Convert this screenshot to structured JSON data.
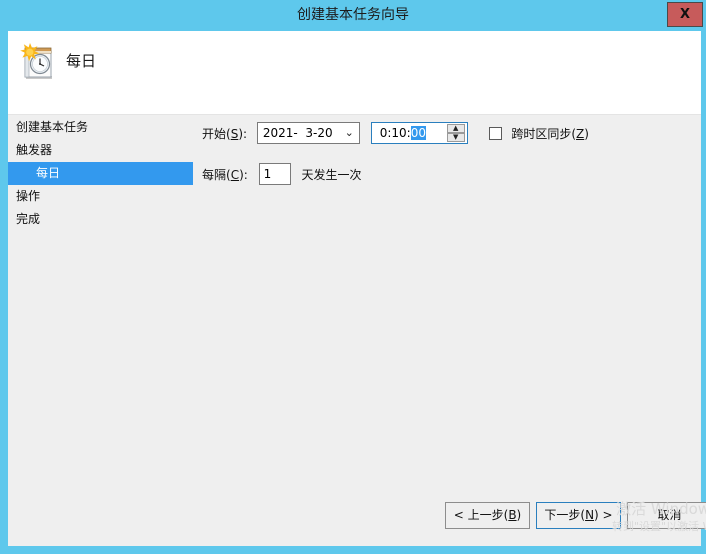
{
  "window": {
    "title": "创建基本任务向导",
    "close_label": "X",
    "frame_color": "#5ec8ec",
    "close_color": "#c75b5b"
  },
  "header": {
    "icon": "calendar-clock-icon",
    "title": "每日"
  },
  "sidebar": {
    "items": [
      {
        "label": "创建基本任务",
        "selected": false,
        "sub": false
      },
      {
        "label": "触发器",
        "selected": false,
        "sub": false
      },
      {
        "label": "每日",
        "selected": true,
        "sub": true
      },
      {
        "label": "操作",
        "selected": false,
        "sub": false
      },
      {
        "label": "完成",
        "selected": false,
        "sub": false
      }
    ],
    "selected_color": "#3399ee"
  },
  "form": {
    "start": {
      "label_pre": "开始(",
      "label_key": "S",
      "label_post": "):",
      "date_value": "2021-  3-20",
      "date_chevron": "chevron-down-icon",
      "time_prefix": "0:10:",
      "time_selected": "00",
      "spin_up": "▲",
      "spin_down": "▼"
    },
    "sync_checkbox": {
      "checked": false,
      "label_pre": "跨时区同步(",
      "label_key": "Z",
      "label_post": ")"
    },
    "recur": {
      "label_pre": "每隔(",
      "label_key": "C",
      "label_post": "):",
      "value": "1",
      "suffix": "天发生一次"
    }
  },
  "footer": {
    "back": {
      "pre": "< 上一步(",
      "key": "B",
      "post": ")"
    },
    "next": {
      "pre": "下一步(",
      "key": "N",
      "post": ") >"
    },
    "cancel": {
      "label": "取消"
    }
  },
  "watermark": {
    "line1": "激活 Windows",
    "line2": "转到\"设置\"以激活 Windows。"
  }
}
